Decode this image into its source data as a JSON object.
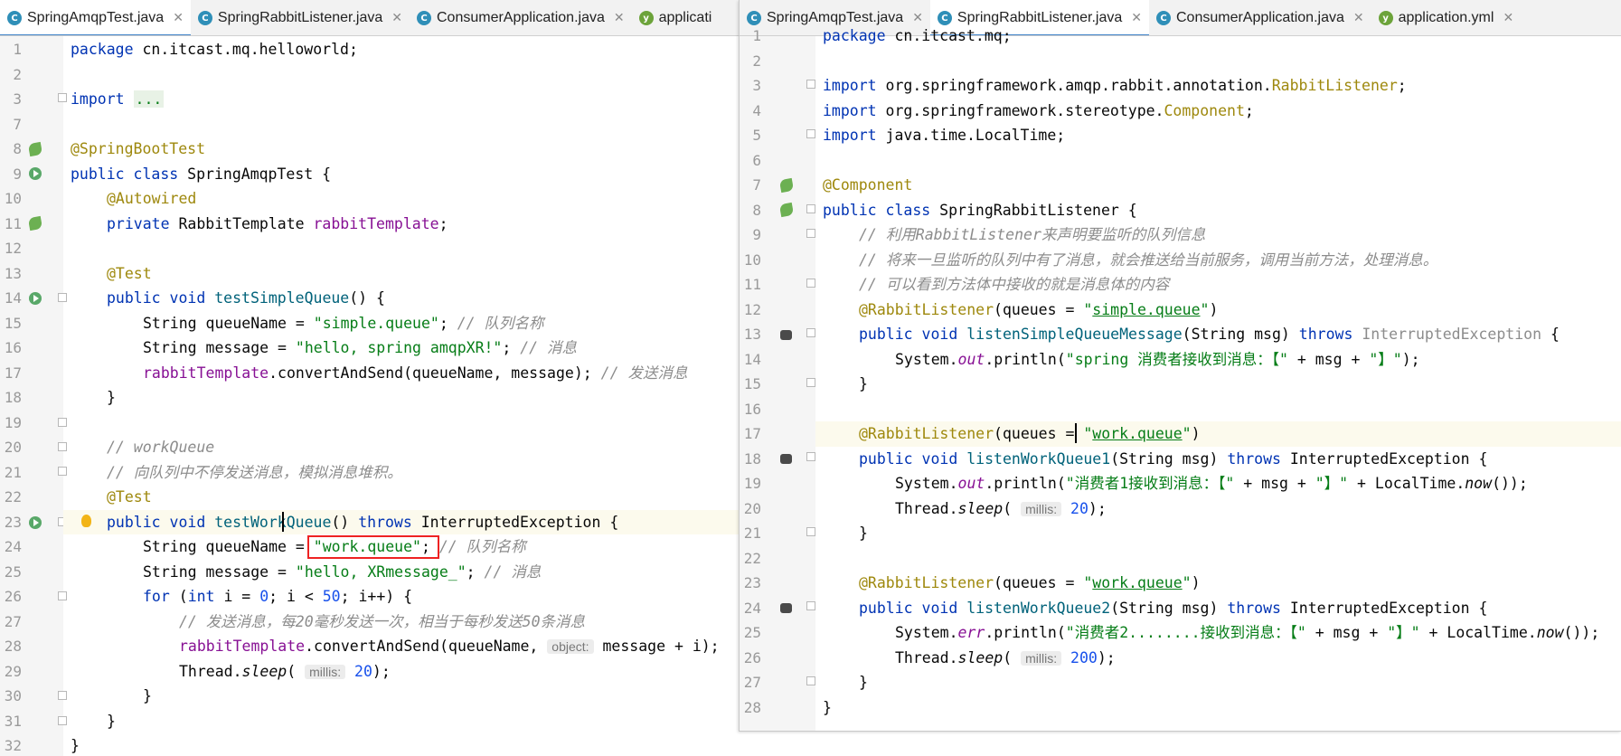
{
  "left": {
    "tabs": [
      {
        "label": "SpringAmqpTest.java",
        "type": "java",
        "active": true
      },
      {
        "label": "SpringRabbitListener.java",
        "type": "java",
        "active": false
      },
      {
        "label": "ConsumerApplication.java",
        "type": "java",
        "active": false
      },
      {
        "label": "applicati",
        "type": "yml",
        "active": false
      }
    ],
    "line_numbers": [
      "1",
      "2",
      "3",
      "7",
      "8",
      "9",
      "10",
      "11",
      "12",
      "13",
      "14",
      "15",
      "16",
      "17",
      "18",
      "19",
      "20",
      "21",
      "22",
      "23",
      "24",
      "25",
      "26",
      "27",
      "28",
      "29",
      "30",
      "31",
      "32"
    ]
  },
  "right": {
    "tabs": [
      {
        "label": "SpringAmqpTest.java",
        "type": "java",
        "active": false
      },
      {
        "label": "SpringRabbitListener.java",
        "type": "java",
        "active": true
      },
      {
        "label": "ConsumerApplication.java",
        "type": "java",
        "active": false
      },
      {
        "label": "application.yml",
        "type": "yml",
        "active": false
      }
    ],
    "line_numbers": [
      "1",
      "2",
      "3",
      "4",
      "5",
      "6",
      "7",
      "8",
      "9",
      "10",
      "11",
      "12",
      "13",
      "14",
      "15",
      "16",
      "17",
      "18",
      "19",
      "20",
      "21",
      "22",
      "23",
      "24",
      "25",
      "26",
      "27",
      "28"
    ]
  },
  "close_glyph": "✕",
  "java_icon_glyph": "C",
  "yml_icon_glyph": "y",
  "code": {
    "package_kw": "package",
    "import_kw": "import",
    "public_kw": "public",
    "class_kw": "class",
    "private_kw": "private",
    "void_kw": "void",
    "throws_kw": "throws",
    "for_kw": "for",
    "int_kw": "int",
    "left_package": "cn.itcast.mq.helloworld;",
    "left_import_fold": "...",
    "ann_springboottest": "@SpringBootTest",
    "left_class_name": "SpringAmqpTest {",
    "ann_autowired": "@Autowired",
    "rabbit_template_type": "RabbitTemplate ",
    "rabbit_template_field": "rabbitTemplate",
    "semicolon": ";",
    "ann_test": "@Test",
    "test_simple_queue": "testSimpleQueue",
    "parens_brace": "() {",
    "string_type": "String ",
    "queue_name_assign": "queueName = ",
    "simple_queue_str": "\"simple.queue\"",
    "semicolon_space": "; ",
    "cmt_queue_name": "// 队列名称",
    "message_assign": "message = ",
    "hello_spring_str": "\"hello, spring amqpXR!\"",
    "cmt_message": "// 消息",
    "convert_and_send_call": ".convertAndSend(queueName, message); ",
    "cmt_send_message": "// 发送消息",
    "close_brace": "}",
    "cmt_workqueue": "// workQueue",
    "cmt_simulate_backlog": "// 向队列中不停发送消息，模拟消息堆积。",
    "test_work_queue": "testWorkQueue",
    "parens": "() ",
    "interrupted_ex_brace": "InterruptedException {",
    "work_queue_str": "\"work.queue\"",
    "hello_xrmessage_str": "\"hello, XRmessage_\"",
    "for_open": "(",
    "i_eq": "i = ",
    "zero": "0",
    "semi_i_lt": "; i < ",
    "fifty": "50",
    "semi_ipp": "; i++) {",
    "cmt_send_rate": "// 发送消息，每20毫秒发送一次，相当于每秒发送50条消息",
    "convert_and_send_open": ".convertAndSend(queueName, ",
    "hint_object": "object:",
    "message_plus_i": " message + i);",
    "thread_sleep": "Thread.",
    "sleep": "sleep",
    "paren_open": "( ",
    "hint_millis": "millis:",
    "twenty": "20",
    "twenty_close": ");",
    "two_hundred": "200",
    "right_package": "cn.itcast.mq;",
    "import_rabbit_pkg": "org.springframework.amqp.rabbit.annotation.",
    "import_rabbit_cls": "RabbitListener",
    "import_component_pkg": "org.springframework.stereotype.",
    "import_component_cls": "Component",
    "import_localtime": "java.time.LocalTime;",
    "ann_component": "@Component",
    "right_class_name": "SpringRabbitListener {",
    "cmt_r9": "// 利用RabbitListener来声明要监听的队列信息",
    "cmt_r10": "// 将来一旦监听的队列中有了消息，就会推送给当前服务，调用当前方法，处理消息。",
    "cmt_r11": "// 可以看到方法体中接收的就是消息体的内容",
    "ann_rabbitlistener": "@RabbitListener",
    "queues_eq": "(queues = ",
    "quote": "\"",
    "simple_queue_inner": "simple.queue",
    "paren_close": ")",
    "listen_simple": "listenSimpleQueueMessage",
    "string_msg_param": "(String msg) ",
    "interrupted_ex_gray": "InterruptedException",
    "brace_open_sp": " {",
    "system": "System.",
    "out": "out",
    "err": "err",
    "println_open": ".println(",
    "spring_consumer_str": "\"spring 消费者接收到消息：【\"",
    "plus_msg_plus": " + msg + ",
    "close_bracket_str": "\"】\"",
    "println_end": ");",
    "work_queue_inner": "work.queue",
    "listen_work1": "listenWorkQueue1",
    "listen_work2": "listenWorkQueue2",
    "consumer1_str": "\"消费者1接收到消息：【\"",
    "consumer2_str": "\"消费者2........接收到消息：【\"",
    "plus_localtime": " + LocalTime.",
    "now": "now",
    "now_end": "());"
  }
}
